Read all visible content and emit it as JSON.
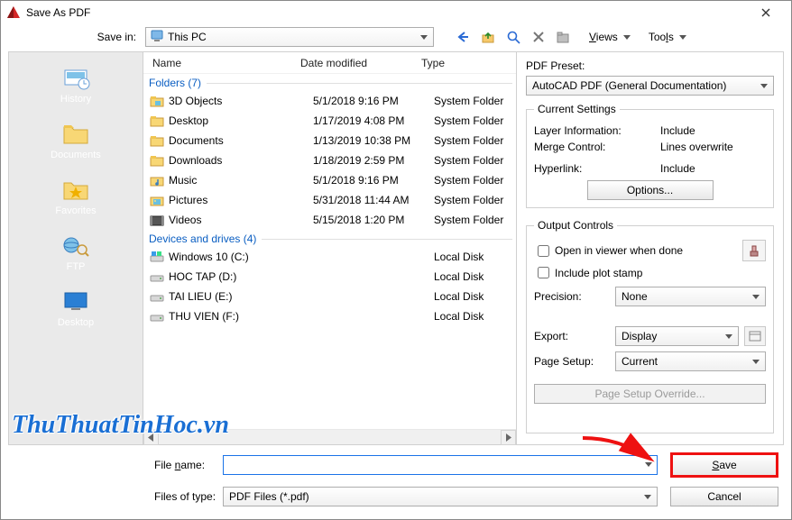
{
  "title": "Save As PDF",
  "savein": {
    "label": "Save in:",
    "value": "This PC"
  },
  "toolbarMenus": {
    "views": "Views",
    "tools": "Tools"
  },
  "columns": {
    "name": "Name",
    "date": "Date modified",
    "type": "Type"
  },
  "groups": {
    "folders": "Folders (7)",
    "drives": "Devices and drives (4)"
  },
  "folders": [
    {
      "name": "3D Objects",
      "date": "5/1/2018 9:16 PM",
      "type": "System Folder",
      "icon": "folder-3d"
    },
    {
      "name": "Desktop",
      "date": "1/17/2019 4:08 PM",
      "type": "System Folder",
      "icon": "folder"
    },
    {
      "name": "Documents",
      "date": "1/13/2019 10:38 PM",
      "type": "System Folder",
      "icon": "folder"
    },
    {
      "name": "Downloads",
      "date": "1/18/2019 2:59 PM",
      "type": "System Folder",
      "icon": "folder"
    },
    {
      "name": "Music",
      "date": "5/1/2018 9:16 PM",
      "type": "System Folder",
      "icon": "music"
    },
    {
      "name": "Pictures",
      "date": "5/31/2018 11:44 AM",
      "type": "System Folder",
      "icon": "pictures"
    },
    {
      "name": "Videos",
      "date": "5/15/2018 1:20 PM",
      "type": "System Folder",
      "icon": "video"
    }
  ],
  "drives": [
    {
      "name": "Windows 10 (C:)",
      "date": "",
      "type": "Local Disk",
      "icon": "drive-win"
    },
    {
      "name": "HOC TAP (D:)",
      "date": "",
      "type": "Local Disk",
      "icon": "drive"
    },
    {
      "name": "TAI LIEU (E:)",
      "date": "",
      "type": "Local Disk",
      "icon": "drive"
    },
    {
      "name": "THU VIEN (F:)",
      "date": "",
      "type": "Local Disk",
      "icon": "drive"
    }
  ],
  "sidebar": {
    "history": "History",
    "documents": "Documents",
    "favorites": "Favorites",
    "ftp": "FTP",
    "desktop": "Desktop"
  },
  "pdf": {
    "presetLabel": "PDF Preset:",
    "presetValue": "AutoCAD PDF (General Documentation)",
    "currentSettings": "Current Settings",
    "layerInfoLabel": "Layer Information:",
    "layerInfoValue": "Include",
    "mergeLabel": "Merge Control:",
    "mergeValue": "Lines overwrite",
    "hyperlinkLabel": "Hyperlink:",
    "hyperlinkValue": "Include",
    "optionsBtn": "Options...",
    "outputControls": "Output Controls",
    "openInViewer": "Open in viewer when done",
    "includePlotStamp": "Include plot stamp",
    "precisionLabel": "Precision:",
    "precisionValue": "None",
    "exportLabel": "Export:",
    "exportValue": "Display",
    "pageSetupLabel": "Page Setup:",
    "pageSetupValue": "Current",
    "pageSetupOverride": "Page Setup Override..."
  },
  "bottom": {
    "filenameLabel": "File name:",
    "filenameValue": "",
    "filetypeLabel": "Files of type:",
    "filetypeValue": "PDF Files (*.pdf)",
    "save": "Save",
    "cancel": "Cancel"
  },
  "watermark": "ThuThuatTinHoc.vn"
}
